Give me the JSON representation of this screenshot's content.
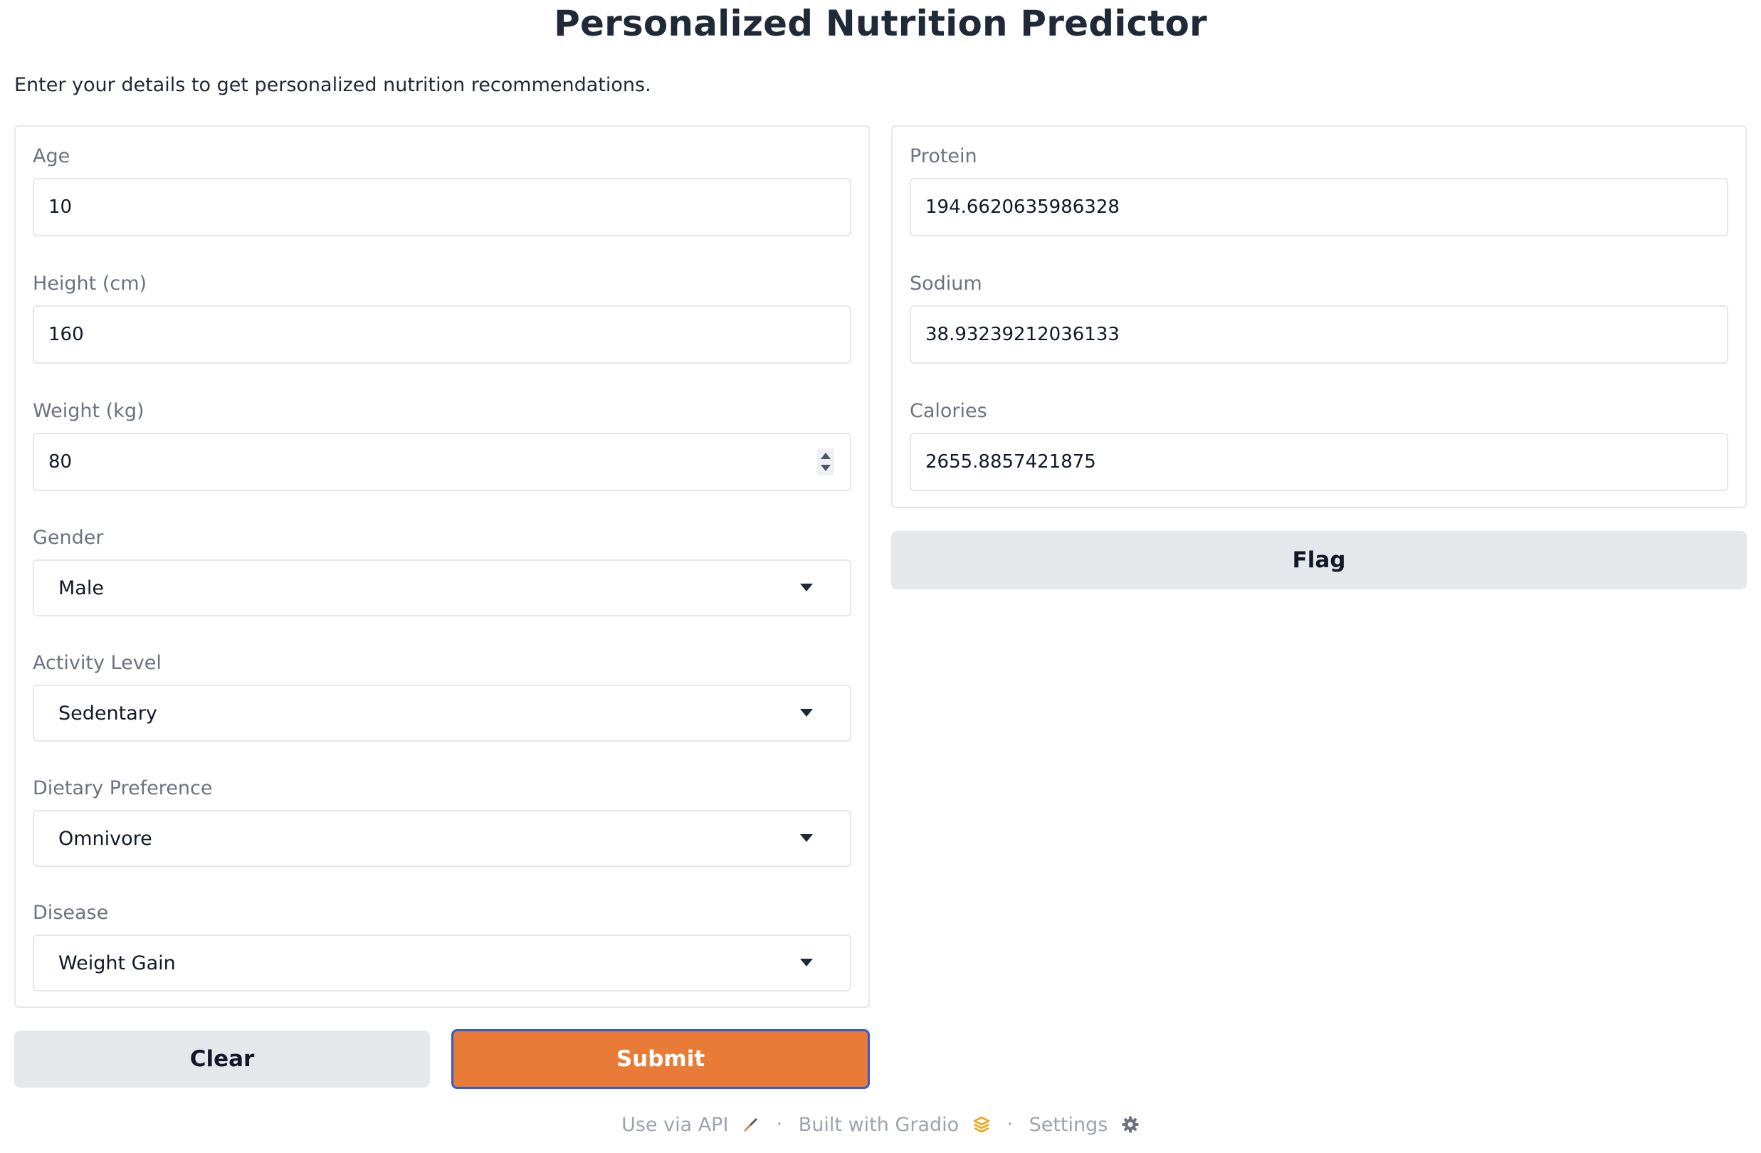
{
  "title": "Personalized Nutrition Predictor",
  "description": "Enter your details to get personalized nutrition recommendations.",
  "inputs": {
    "age": {
      "label": "Age",
      "value": "10"
    },
    "height": {
      "label": "Height (cm)",
      "value": "160"
    },
    "weight": {
      "label": "Weight (kg)",
      "value": "80"
    },
    "gender": {
      "label": "Gender",
      "value": "Male"
    },
    "activity": {
      "label": "Activity Level",
      "value": "Sedentary"
    },
    "diet": {
      "label": "Dietary Preference",
      "value": "Omnivore"
    },
    "disease": {
      "label": "Disease",
      "value": "Weight Gain"
    }
  },
  "outputs": {
    "protein": {
      "label": "Protein",
      "value": "194.6620635986328"
    },
    "sodium": {
      "label": "Sodium",
      "value": "38.93239212036133"
    },
    "calories": {
      "label": "Calories",
      "value": "2655.8857421875"
    }
  },
  "buttons": {
    "clear": "Clear",
    "submit": "Submit",
    "flag": "Flag"
  },
  "footer": {
    "api": "Use via API",
    "built": "Built with Gradio",
    "settings": "Settings",
    "separator": "·"
  },
  "colors": {
    "accent": "#e87b35",
    "focus_border": "#2f5bd6"
  }
}
